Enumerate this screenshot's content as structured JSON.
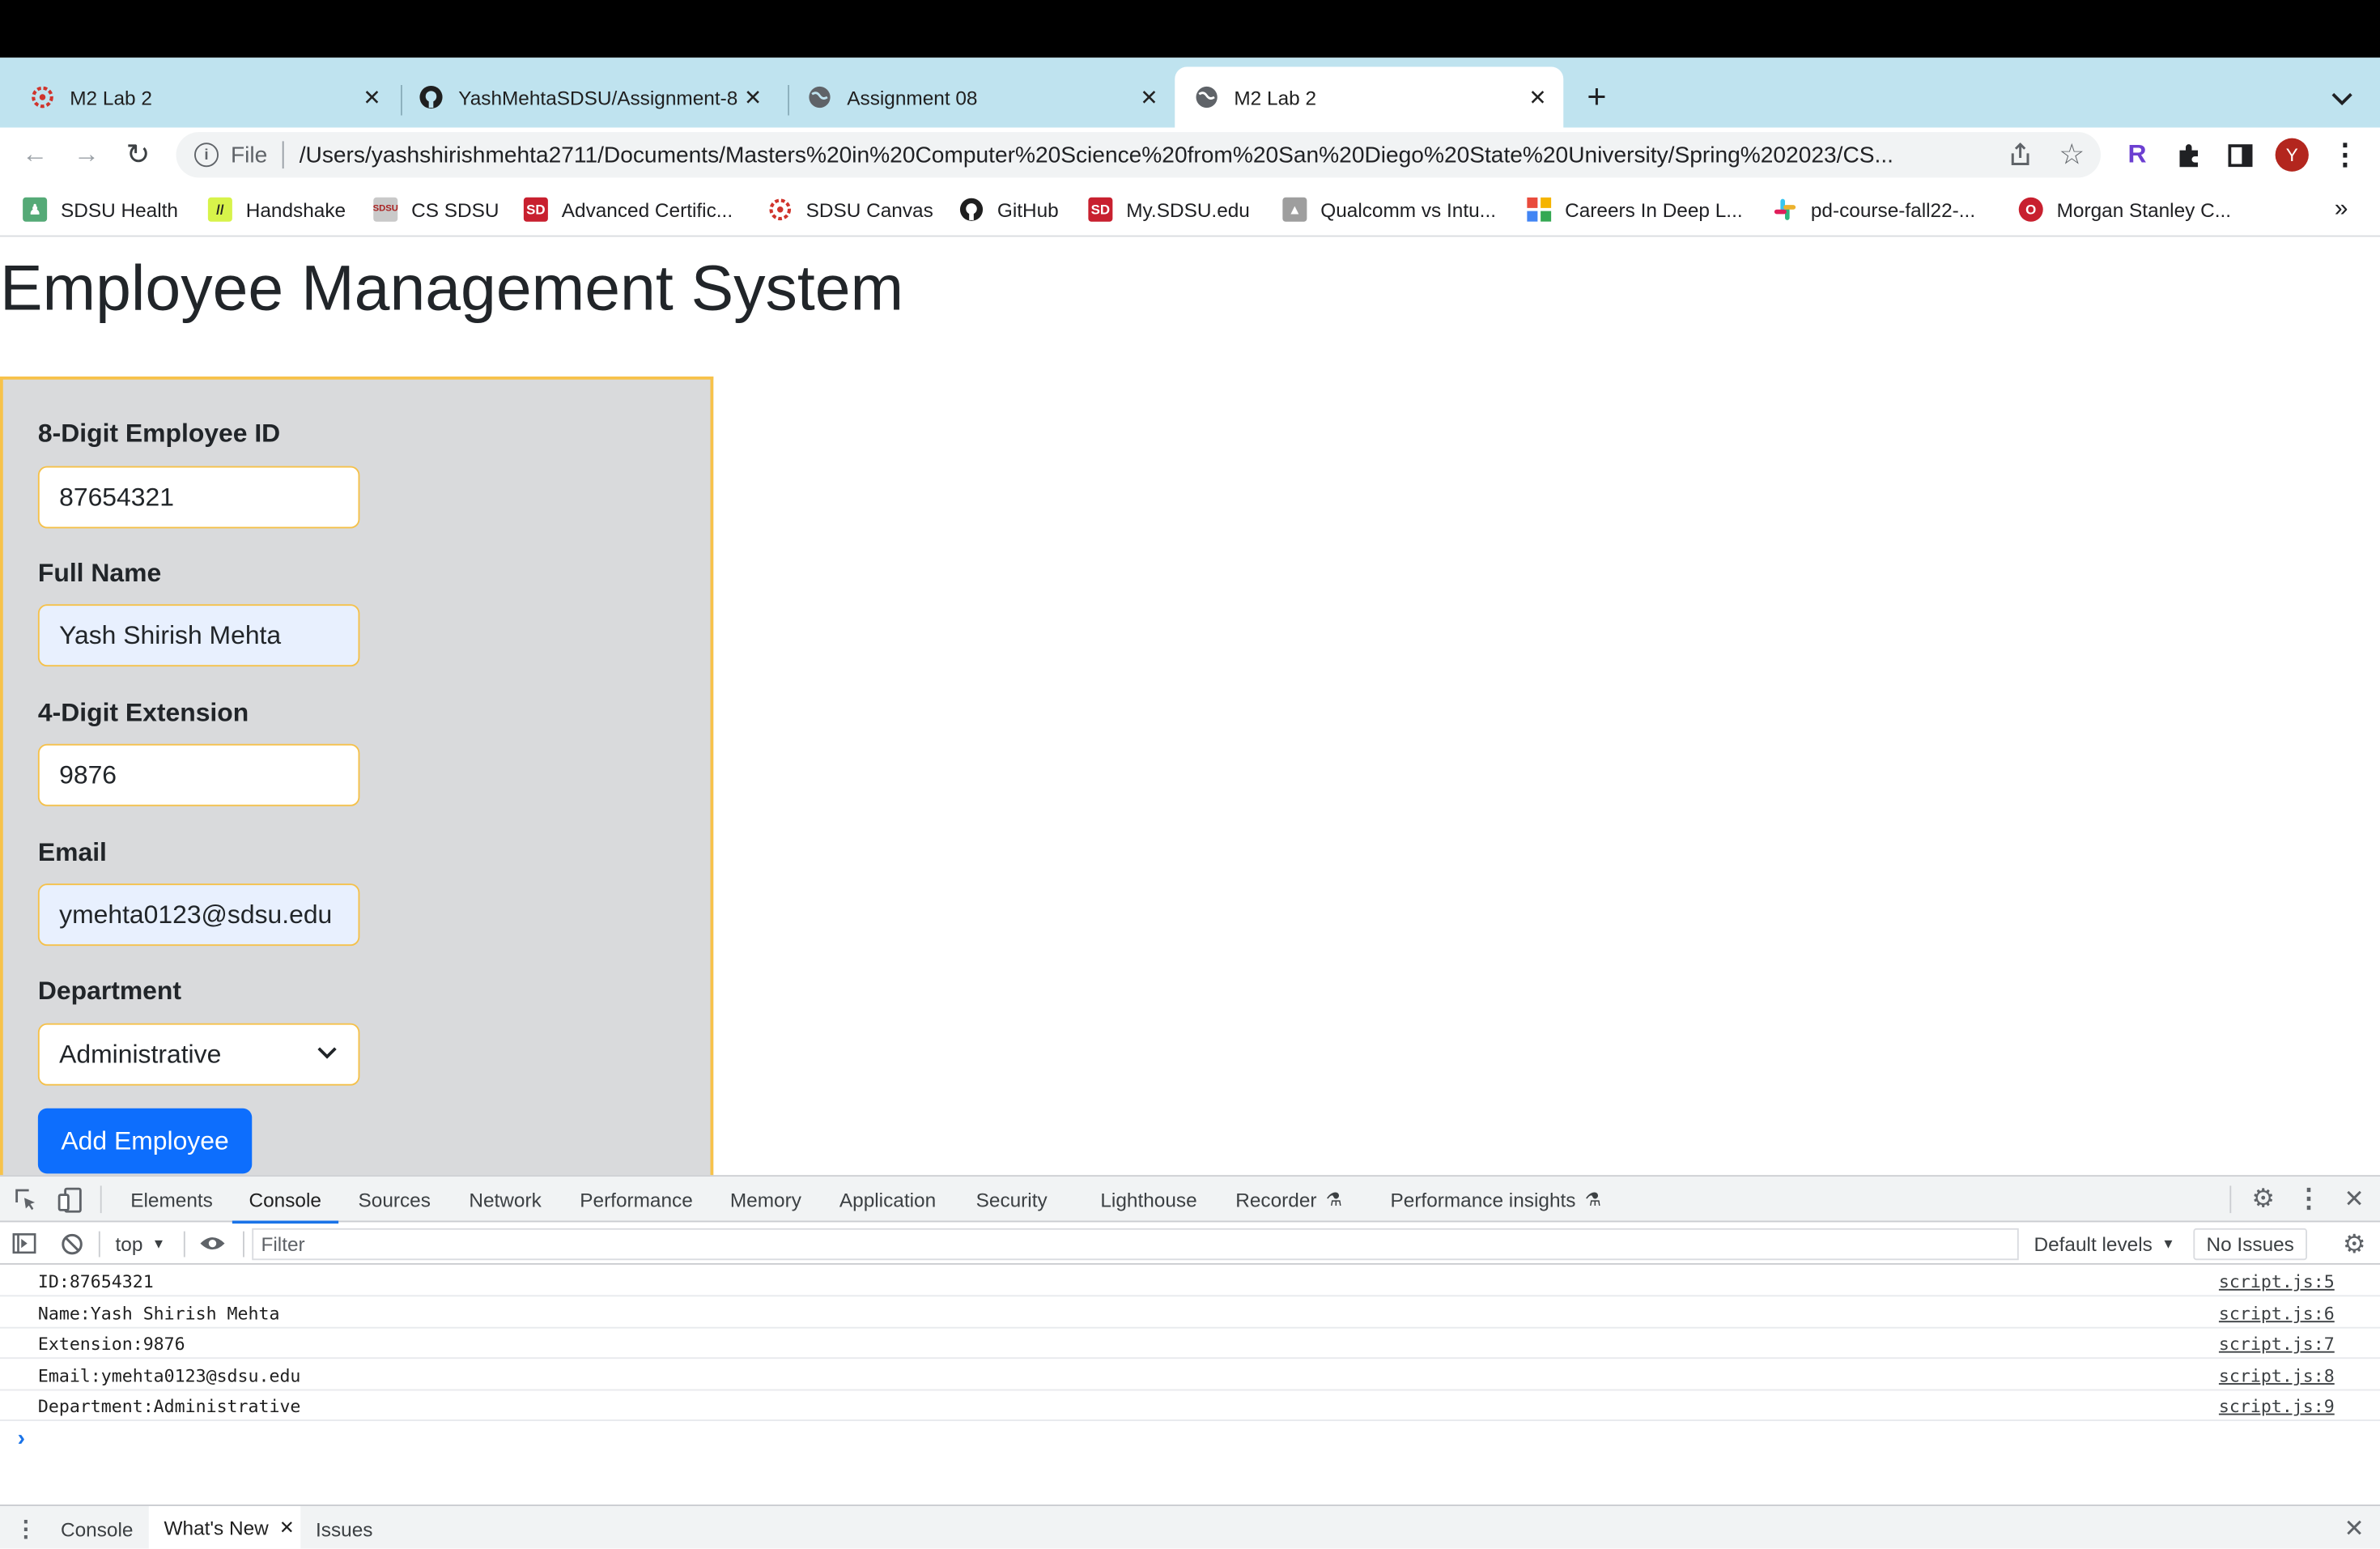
{
  "browser": {
    "tabs": [
      {
        "title": "M2 Lab 2",
        "icon": "sdsu-canvas-icon",
        "active": false
      },
      {
        "title": "YashMehtaSDSU/Assignment-8",
        "icon": "github-icon",
        "active": false
      },
      {
        "title": "Assignment 08",
        "icon": "globe-icon",
        "active": false
      },
      {
        "title": "M2 Lab 2",
        "icon": "globe-icon",
        "active": true
      }
    ],
    "omnibox": {
      "scheme_label": "File",
      "url": "/Users/yashshirishmehta2711/Documents/Masters%20in%20Computer%20Science%20from%20San%20Diego%20State%20University/Spring%202023/CS..."
    },
    "profile_initial": "Y",
    "bookmarks": [
      "SDSU Health",
      "Handshake",
      "CS SDSU",
      "Advanced Certific...",
      "SDSU Canvas",
      "GitHub",
      "My.SDSU.edu",
      "Qualcomm vs Intu...",
      "Careers In Deep L...",
      "pd-course-fall22-...",
      "Morgan Stanley C..."
    ],
    "bookmarks_overflow": "»"
  },
  "page": {
    "title": "Employee Management System",
    "form": {
      "employee_id_label": "8-Digit Employee ID",
      "employee_id_value": "87654321",
      "full_name_label": "Full Name",
      "full_name_value": "Yash Shirish Mehta",
      "extension_label": "4-Digit Extension",
      "extension_value": "9876",
      "email_label": "Email",
      "email_value": "ymehta0123@sdsu.edu",
      "department_label": "Department",
      "department_value": "Administrative",
      "submit_label": "Add Employee"
    }
  },
  "devtools": {
    "tabs": [
      "Elements",
      "Console",
      "Sources",
      "Network",
      "Performance",
      "Memory",
      "Application",
      "Security",
      "Lighthouse",
      "Recorder",
      "Performance insights"
    ],
    "selected_tab": "Console",
    "context": "top",
    "filter_placeholder": "Filter",
    "levels": "Default levels",
    "issues": "No Issues",
    "logs": [
      {
        "message": "ID:87654321",
        "source": "script.js:5"
      },
      {
        "message": "Name:Yash Shirish Mehta",
        "source": "script.js:6"
      },
      {
        "message": "Extension:9876",
        "source": "script.js:7"
      },
      {
        "message": "Email:ymehta0123@sdsu.edu",
        "source": "script.js:8"
      },
      {
        "message": "Department:Administrative",
        "source": "script.js:9"
      }
    ],
    "prompt": "›",
    "drawer_tabs": [
      "Console",
      "What's New",
      "Issues"
    ],
    "drawer_selected": "What's New"
  }
}
